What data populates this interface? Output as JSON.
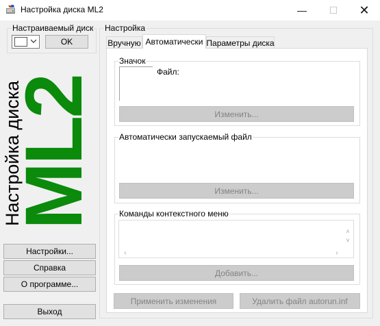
{
  "window": {
    "title": "Настройка диска ML2",
    "minimize_glyph": "—",
    "maximize_glyph": "☐",
    "close_glyph": "✕"
  },
  "left": {
    "drive_group_label": "Настраиваемый диск",
    "ok_label": "OK",
    "side_title_small": "Настройка диска",
    "side_title_big": "ML2",
    "settings_button": "Настройки...",
    "help_button": "Справка",
    "about_button": "О программе...",
    "exit_button": "Выход"
  },
  "settings": {
    "group_label": "Настройка",
    "tabs": [
      {
        "label": "Вручную",
        "active": false
      },
      {
        "label": "Автоматически",
        "active": true
      },
      {
        "label": "Параметры диска",
        "active": false
      }
    ],
    "icon_group_label": "Значок",
    "file_label": "Файл:",
    "icon_change_button": "Изменить...",
    "autorun_group_label": "Автоматически запускаемый файл",
    "autorun_change_button": "Изменить...",
    "context_group_label": "Команды контекстного меню",
    "add_button": "Добавить...",
    "apply_button": "Применить изменения",
    "delete_button": "Удалить файл autorun.inf"
  },
  "colors": {
    "accent_green": "#0b8a0b",
    "window_bg": "#f0f0f0"
  }
}
